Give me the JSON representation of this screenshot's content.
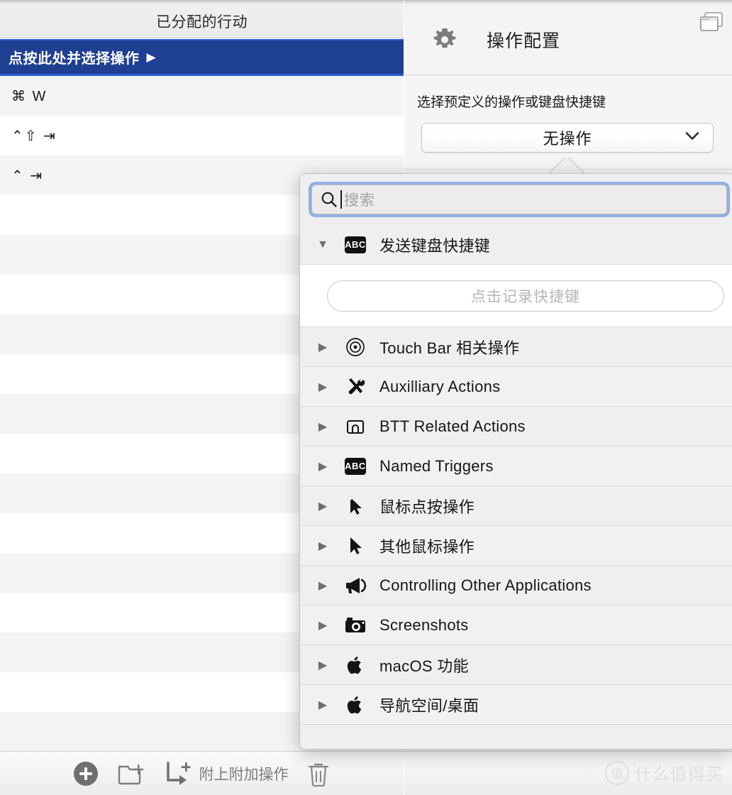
{
  "left_panel": {
    "header_title": "已分配的行动",
    "rows": [
      {
        "label": "点按此处并选择操作",
        "arrow": "▶",
        "selected": true
      },
      {
        "label": "⌘ W",
        "selected": false
      },
      {
        "label": "⌃⇧ ⇥",
        "selected": false
      },
      {
        "label": "⌃ ⇥",
        "selected": false
      },
      {
        "label": "",
        "selected": false
      },
      {
        "label": "",
        "selected": false
      },
      {
        "label": "",
        "selected": false
      },
      {
        "label": "",
        "selected": false
      },
      {
        "label": "",
        "selected": false
      },
      {
        "label": "",
        "selected": false
      },
      {
        "label": "",
        "selected": false
      },
      {
        "label": "",
        "selected": false
      },
      {
        "label": "",
        "selected": false
      },
      {
        "label": "",
        "selected": false
      },
      {
        "label": "",
        "selected": false
      },
      {
        "label": "",
        "selected": false
      },
      {
        "label": "",
        "selected": false
      },
      {
        "label": "",
        "selected": false
      }
    ],
    "toolbar": {
      "add_icon": "plus-circle-icon",
      "new_folder_icon": "folder-plus-icon",
      "attach_icon": "attach-action-icon",
      "attach_label": "附上附加操作",
      "delete_icon": "trash-icon"
    }
  },
  "right_panel": {
    "gear_icon": "gear-icon",
    "panel_title": "操作配置",
    "window_icon": "windows-stack-icon",
    "field_label": "选择预定义的操作或键盘快捷键",
    "select_value": "无操作",
    "select_chevron": "chevron-down-icon"
  },
  "popover": {
    "search": {
      "icon": "search-icon",
      "placeholder": "搜索",
      "value": ""
    },
    "expanded_group": {
      "disclosure": "▼",
      "icon": "abc-badge-icon",
      "icon_text": "ABC",
      "label": "发送键盘快捷键",
      "recorder_placeholder": "点击记录快捷键"
    },
    "categories": [
      {
        "disclosure": "▶",
        "icon": "touchbar-target-icon",
        "label": "Touch Bar 相关操作"
      },
      {
        "disclosure": "▶",
        "icon": "tools-icon",
        "label": "Auxilliary Actions"
      },
      {
        "disclosure": "▶",
        "icon": "btt-window-icon",
        "label": "BTT Related Actions"
      },
      {
        "disclosure": "▶",
        "icon": "abc-badge-icon",
        "icon_text": "ABC",
        "label": "Named Triggers"
      },
      {
        "disclosure": "▶",
        "icon": "cursor-arrow-icon",
        "label": "鼠标点按操作"
      },
      {
        "disclosure": "▶",
        "icon": "cursor-arrow-icon",
        "label": "其他鼠标操作"
      },
      {
        "disclosure": "▶",
        "icon": "megaphone-icon",
        "label": "Controlling Other Applications"
      },
      {
        "disclosure": "▶",
        "icon": "camera-icon",
        "label": "Screenshots"
      },
      {
        "disclosure": "▶",
        "icon": "apple-logo-icon",
        "label": "macOS 功能"
      },
      {
        "disclosure": "▶",
        "icon": "apple-logo-icon",
        "label": "导航空间/桌面"
      }
    ]
  },
  "watermark": {
    "mark": "值",
    "text": "什么值得买"
  },
  "colors": {
    "selection_blue": "#1f3f92",
    "selection_border": "#2a5bd7",
    "focus_ring": "#6e96e1",
    "panel_bg": "#f5f5f5",
    "popover_bg": "#efefef"
  }
}
